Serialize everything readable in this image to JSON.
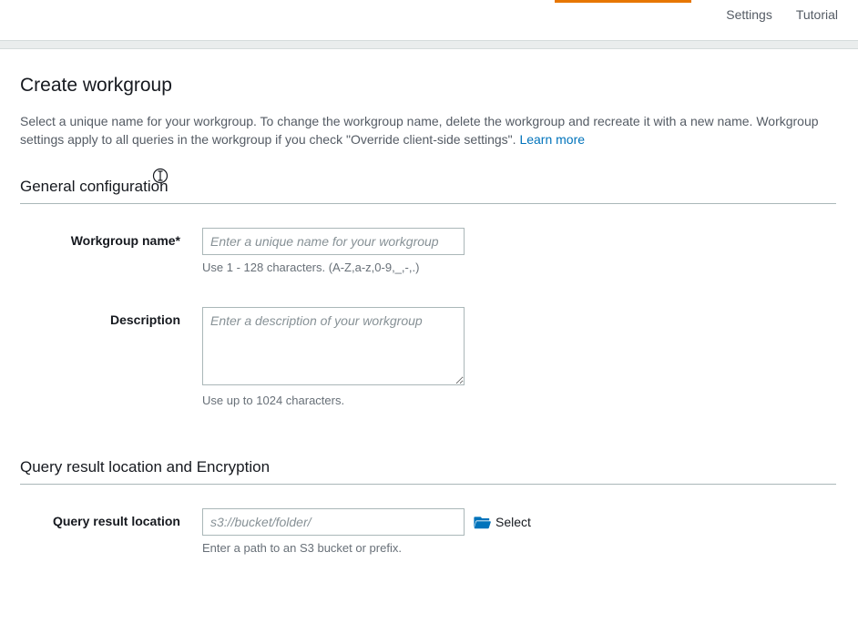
{
  "nav": {
    "settings": "Settings",
    "tutorial": "Tutorial"
  },
  "page": {
    "title": "Create workgroup",
    "intro": "Select a unique name for your workgroup. To change the workgroup name, delete the workgroup and recreate it with a new name. Workgroup settings apply to all queries in the workgroup if you check \"Override client-side settings\".",
    "learn_more": "Learn more"
  },
  "sections": {
    "general": "General configuration",
    "query": "Query result location and Encryption"
  },
  "fields": {
    "name": {
      "label": "Workgroup name*",
      "placeholder": "Enter a unique name for your workgroup",
      "help": "Use 1 - 128 characters. (A-Z,a-z,0-9,_,-,.)"
    },
    "description": {
      "label": "Description",
      "placeholder": "Enter a description of your workgroup",
      "help": "Use up to 1024 characters."
    },
    "location": {
      "label": "Query result location",
      "placeholder": "s3://bucket/folder/",
      "help": "Enter a path to an S3 bucket or prefix.",
      "select_label": "Select"
    }
  }
}
